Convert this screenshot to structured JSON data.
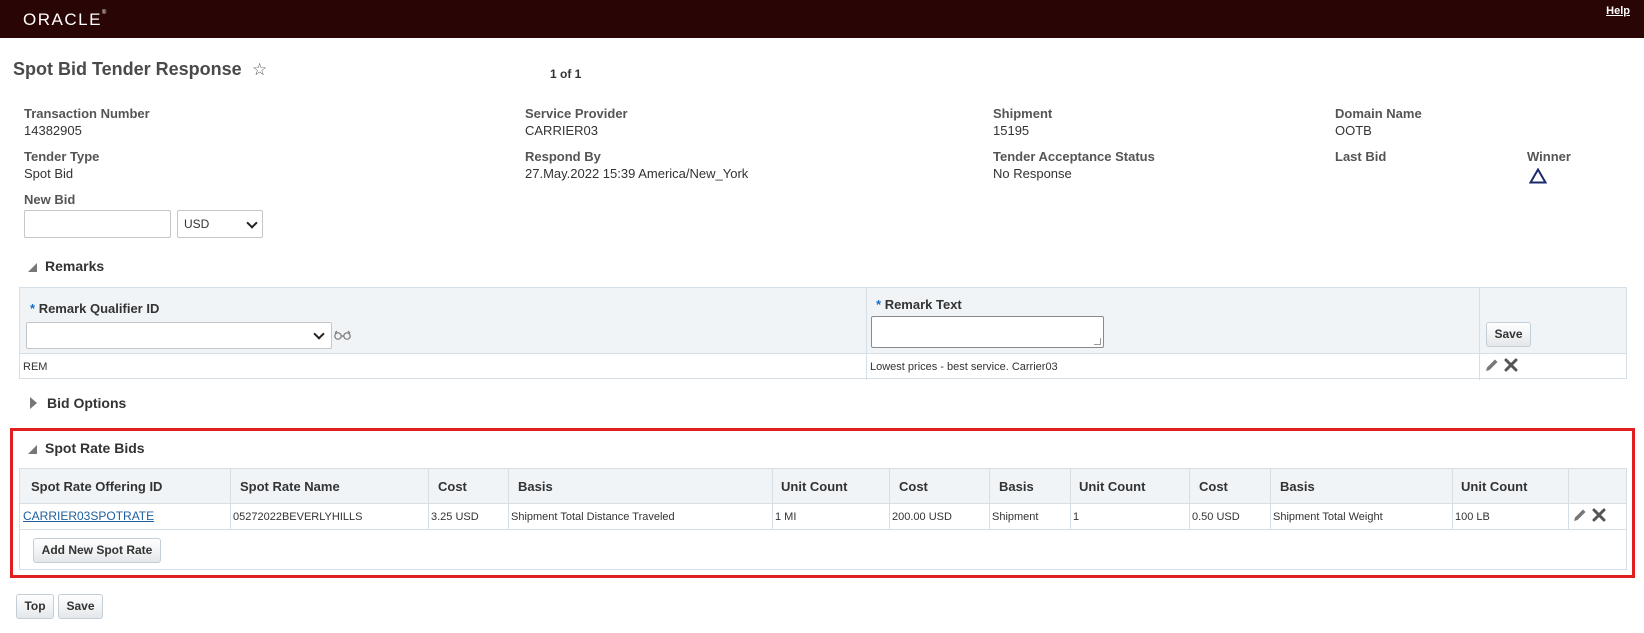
{
  "app": {
    "logo": "ORACLE",
    "help": "Help"
  },
  "page": {
    "title": "Spot Bid Tender Response",
    "pager": "1 of 1"
  },
  "fields": {
    "transaction_number": {
      "label": "Transaction Number",
      "value": "14382905"
    },
    "service_provider": {
      "label": "Service Provider",
      "value": "CARRIER03"
    },
    "shipment": {
      "label": "Shipment",
      "value": "15195"
    },
    "domain_name": {
      "label": "Domain Name",
      "value": "OOTB"
    },
    "tender_type": {
      "label": "Tender Type",
      "value": "Spot Bid"
    },
    "respond_by": {
      "label": "Respond By",
      "value": "27.May.2022 15:39 America/New_York"
    },
    "tender_acceptance_status": {
      "label": "Tender Acceptance Status",
      "value": "No Response"
    },
    "last_bid": {
      "label": "Last Bid",
      "value": ""
    },
    "winner": {
      "label": "Winner",
      "icon": "triangle-outline-icon"
    },
    "new_bid": {
      "label": "New Bid",
      "value": "",
      "currency": "USD"
    }
  },
  "remarks": {
    "title": "Remarks",
    "required_mark": "*",
    "col_qualifier": "Remark Qualifier ID",
    "col_text": "Remark Text",
    "save_label": "Save",
    "rows": [
      {
        "qualifier": "REM",
        "text": "Lowest prices - best service. Carrier03"
      }
    ]
  },
  "bid_options": {
    "title": "Bid Options"
  },
  "spot_rate_bids": {
    "title": "Spot Rate Bids",
    "headers": [
      "Spot Rate Offering ID",
      "Spot Rate Name",
      "Cost",
      "Basis",
      "Unit Count",
      "Cost",
      "Basis",
      "Unit Count",
      "Cost",
      "Basis",
      "Unit Count"
    ],
    "rows": [
      {
        "offering_id": "CARRIER03SPOTRATE",
        "name": "05272022BEVERLYHILLS",
        "cost1": "3.25 USD",
        "basis1": "Shipment Total Distance Traveled",
        "unit1": "1 MI",
        "cost2": "200.00 USD",
        "basis2": "Shipment",
        "unit2": "1",
        "cost3": "0.50 USD",
        "basis3": "Shipment Total Weight",
        "unit3": "100 LB"
      }
    ],
    "add_label": "Add New Spot Rate"
  },
  "footer": {
    "top_label": "Top",
    "save_label": "Save"
  },
  "colors": {
    "topbar": "#2a0506",
    "highlight": "#e0201e",
    "link": "#1f5f9e",
    "required": "#1a6fc6"
  }
}
